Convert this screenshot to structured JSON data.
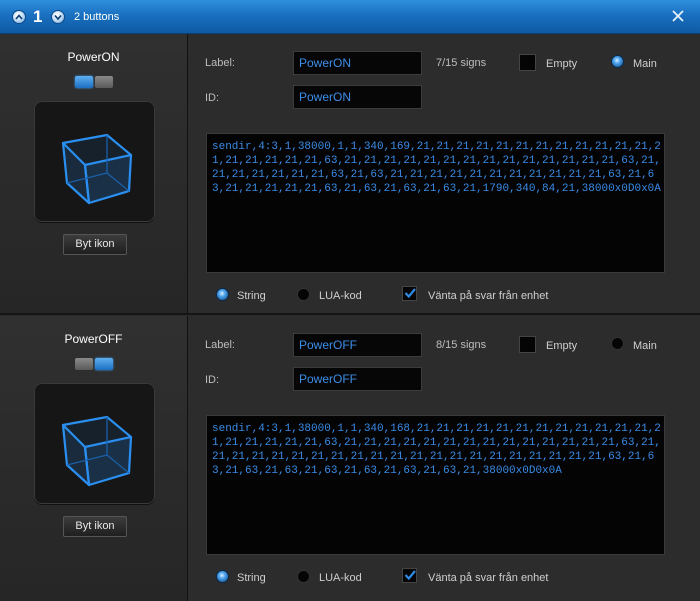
{
  "titlebar": {
    "count": "1",
    "title": "2 buttons",
    "close_label": "X"
  },
  "labels": {
    "label": "Label:",
    "id": "ID:",
    "empty": "Empty",
    "main": "Main",
    "string": "String",
    "lua": "LUA-kod",
    "wait": "Vänta på svar från enhet",
    "change_icon": "Byt ikon"
  },
  "buttons": [
    {
      "name": "PowerON",
      "label_value": "PowerON",
      "id_value": "PowerON",
      "signs": "7/15 signs",
      "empty_checked": false,
      "main_selected": true,
      "toggle": "left-on",
      "mode": "String",
      "wait_checked": true,
      "code": "sendir,4:3,1,38000,1,1,340,169,21,21,21,21,21,21,21,21,21,21,21,21,21,21,21,21,21,21,63,21,21,21,21,21,21,21,21,21,21,21,21,21,21,63,21,21,21,21,21,21,21,63,21,63,21,21,21,21,21,21,21,21,21,21,21,63,21,63,21,21,21,21,21,63,21,63,21,63,21,63,21,1790,340,84,21,38000x0D0x0A"
    },
    {
      "name": "PowerOFF",
      "label_value": "PowerOFF",
      "id_value": "PowerOFF",
      "signs": "8/15 signs",
      "empty_checked": false,
      "main_selected": false,
      "toggle": "right-on",
      "mode": "String",
      "wait_checked": true,
      "code": "sendir,4:3,1,38000,1,1,340,168,21,21,21,21,21,21,21,21,21,21,21,21,21,21,21,21,21,21,63,21,21,21,21,21,21,21,21,21,21,21,21,21,21,63,21,21,21,21,21,21,21,21,21,21,21,21,21,21,21,21,21,21,21,21,21,63,21,63,21,63,21,63,21,63,21,63,21,63,21,63,21,38000x0D0x0A"
    }
  ]
}
